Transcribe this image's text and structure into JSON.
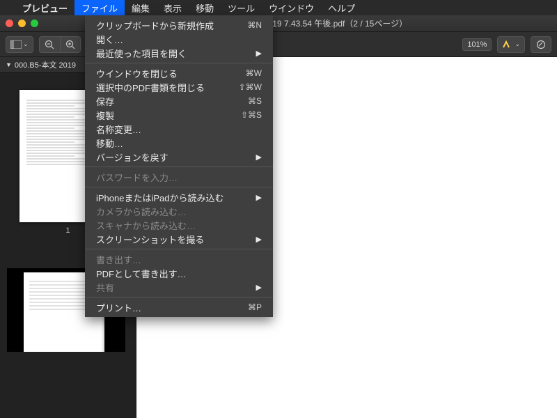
{
  "menubar": {
    "app_name": "プレビュー",
    "items": [
      "ファイル",
      "編集",
      "表示",
      "移動",
      "ツール",
      "ウインドウ",
      "ヘルプ"
    ],
    "active_index": 0
  },
  "window": {
    "title": "000.B5-本文 2019-07-19 7.43.54 午後.pdf（2 / 15ページ）"
  },
  "toolbar": {
    "zoom_label": "101%"
  },
  "sidebar": {
    "tab_label": "000.B5-本文 2019",
    "page_number": "1"
  },
  "file_menu": {
    "new_from_clipboard": "クリップボードから新規作成",
    "open": "開く…",
    "open_recent": "最近使った項目を開く",
    "close_window": "ウインドウを閉じる",
    "close_selected_pdf": "選択中のPDF書類を閉じる",
    "save": "保存",
    "duplicate": "複製",
    "rename": "名称変更…",
    "move_to": "移動…",
    "revert_to": "バージョンを戻す",
    "enter_password": "パスワードを入力…",
    "import_iphone_ipad": "iPhoneまたはiPadから読み込む",
    "import_camera": "カメラから読み込む…",
    "import_scanner": "スキャナから読み込む…",
    "take_screenshot": "スクリーンショットを撮る",
    "export": "書き出す…",
    "export_as_pdf": "PDFとして書き出す…",
    "share": "共有",
    "print": "プリント…",
    "sc_new": "⌘N",
    "sc_close_win": "⌘W",
    "sc_close_sel": "⇧⌘W",
    "sc_save": "⌘S",
    "sc_dup": "⇧⌘S",
    "sc_print": "⌘P",
    "submenu_arrow": "▶"
  }
}
